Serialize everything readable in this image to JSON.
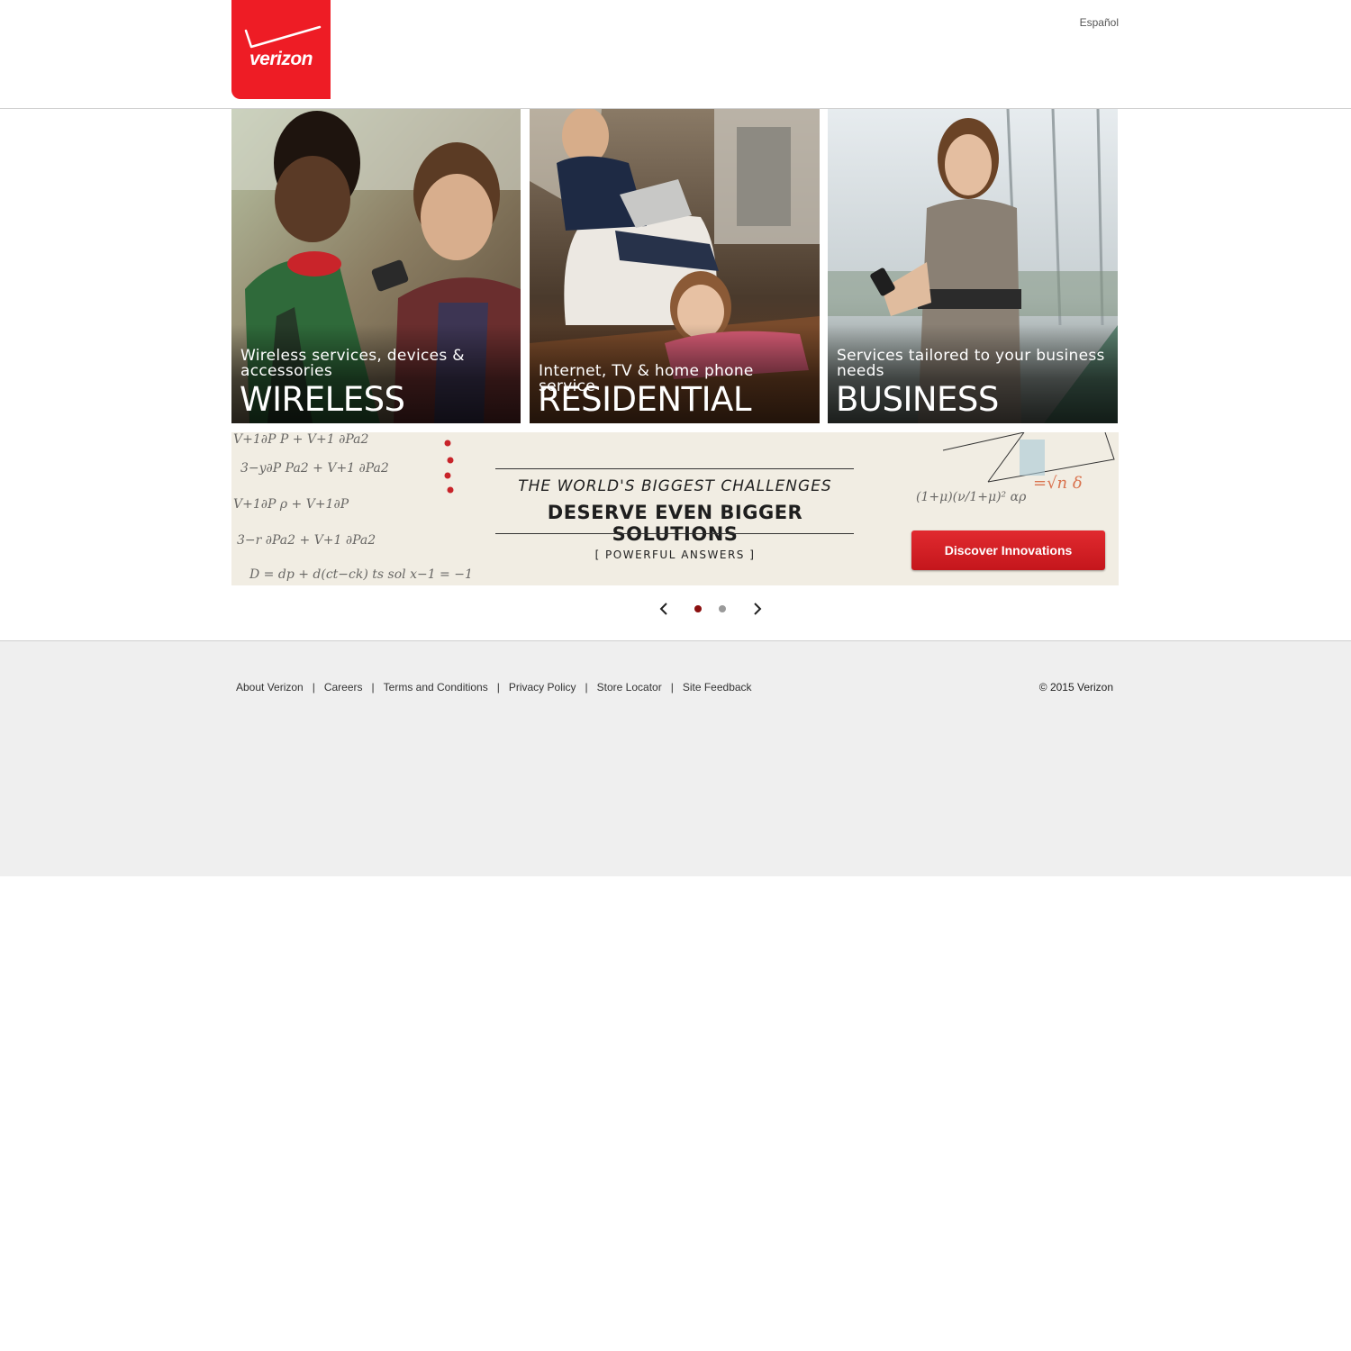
{
  "header": {
    "logo_text": "verizon",
    "language_link": "Español"
  },
  "tiles": [
    {
      "subtitle": "Wireless services, devices & accessories",
      "title": "WIRELESS"
    },
    {
      "subtitle": "Internet, TV & home phone service",
      "title": "RESIDENTIAL"
    },
    {
      "subtitle": "Services tailored to your business needs",
      "title": "BUSINESS"
    }
  ],
  "banner": {
    "line1": "THE WORLD'S BIGGEST CHALLENGES",
    "line2": "DESERVE EVEN BIGGER SOLUTIONS",
    "line3": "[ POWERFUL ANSWERS ]",
    "cta_label": "Discover Innovations"
  },
  "carousel": {
    "slide_count": 2,
    "active_slide": 1,
    "active_color": "#8b0f0f",
    "inactive_color": "#9a9a9a"
  },
  "footer": {
    "links": [
      "About Verizon",
      "Careers",
      "Terms and Conditions",
      "Privacy Policy",
      "Store Locator",
      "Site Feedback"
    ],
    "separator": "|",
    "copyright": "© 2015 Verizon"
  },
  "colors": {
    "brand_red": "#ee1c25",
    "cta_red": "#d0202a",
    "footer_bg": "#efefef"
  }
}
